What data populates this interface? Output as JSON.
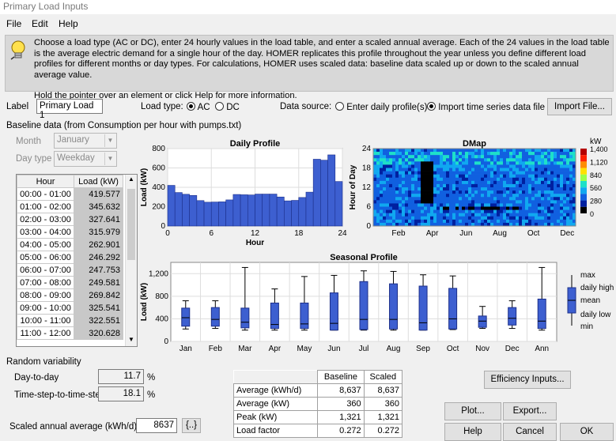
{
  "window": {
    "title": "Primary Load Inputs"
  },
  "menu": [
    "File",
    "Edit",
    "Help"
  ],
  "info": {
    "text": "Choose a load type (AC or DC), enter 24 hourly values in the load table, and enter a scaled annual average. Each of the 24 values in the load table is the average electric demand for a single hour of the day. HOMER replicates this profile throughout the year unless you define different load profiles for different months or day types. For calculations, HOMER uses scaled data: baseline data scaled up or down to the scaled annual average value.",
    "hint": "Hold the pointer over an element or click Help for more information."
  },
  "label_row": {
    "label": "Label",
    "label_value": "Primary Load 1",
    "load_type_label": "Load type:",
    "ac": "AC",
    "dc": "DC",
    "data_source_label": "Data source:",
    "enter_daily": "Enter daily profile(s)",
    "import_ts": "Import time series data file",
    "import_button": "Import File..."
  },
  "baseline_title": "Baseline data (from Consumption per hour with pumps.txt)",
  "month": {
    "label": "Month",
    "value": "January"
  },
  "day_type": {
    "label": "Day type",
    "value": "Weekday"
  },
  "load_table": {
    "headers": [
      "Hour",
      "Load (kW)"
    ],
    "rows": [
      [
        "00:00 - 01:00",
        "419.577"
      ],
      [
        "01:00 - 02:00",
        "345.632"
      ],
      [
        "02:00 - 03:00",
        "327.641"
      ],
      [
        "03:00 - 04:00",
        "315.979"
      ],
      [
        "04:00 - 05:00",
        "262.901"
      ],
      [
        "05:00 - 06:00",
        "246.292"
      ],
      [
        "06:00 - 07:00",
        "247.753"
      ],
      [
        "07:00 - 08:00",
        "249.581"
      ],
      [
        "08:00 - 09:00",
        "269.842"
      ],
      [
        "09:00 - 10:00",
        "325.541"
      ],
      [
        "10:00 - 11:00",
        "322.551"
      ],
      [
        "11:00 - 12:00",
        "320.628"
      ]
    ]
  },
  "random_variability": {
    "title": "Random variability",
    "day_to_day_label": "Day-to-day",
    "day_to_day_value": "11.7",
    "timestep_label": "Time-step-to-time-step",
    "timestep_value": "18.1",
    "unit": "%"
  },
  "scaled": {
    "label": "Scaled annual average (kWh/d)",
    "value": "8637",
    "button": "{..}"
  },
  "stats": {
    "headers": [
      "",
      "Baseline",
      "Scaled"
    ],
    "rows": [
      [
        "Average (kWh/d)",
        "8,637",
        "8,637"
      ],
      [
        "Average (kW)",
        "360",
        "360"
      ],
      [
        "Peak (kW)",
        "1,321",
        "1,321"
      ],
      [
        "Load factor",
        "0.272",
        "0.272"
      ]
    ]
  },
  "buttons": {
    "efficiency": "Efficiency Inputs...",
    "plot": "Plot...",
    "export": "Export...",
    "help": "Help",
    "cancel": "Cancel",
    "ok": "OK"
  },
  "chart_data": [
    {
      "type": "bar",
      "title": "Daily Profile",
      "xlabel": "Hour",
      "ylabel": "Load (kW)",
      "x": [
        0,
        1,
        2,
        3,
        4,
        5,
        6,
        7,
        8,
        9,
        10,
        11,
        12,
        13,
        14,
        15,
        16,
        17,
        18,
        19,
        20,
        21,
        22,
        23
      ],
      "values": [
        420,
        346,
        328,
        316,
        263,
        246,
        248,
        250,
        270,
        326,
        323,
        321,
        330,
        330,
        330,
        300,
        260,
        265,
        295,
        350,
        690,
        680,
        735,
        460
      ],
      "xticks": [
        "0",
        "6",
        "12",
        "18",
        "24"
      ],
      "yticks": [
        "0",
        "200",
        "400",
        "600",
        "800"
      ],
      "ylim": [
        0,
        800
      ],
      "xlim": [
        0,
        24
      ],
      "bar_color": "#3d5fd0",
      "grid": true
    },
    {
      "type": "heatmap",
      "title": "DMap",
      "ylabel": "Hour of Day",
      "xticks": [
        "Feb",
        "Apr",
        "Jun",
        "Aug",
        "Oct",
        "Dec"
      ],
      "yticks": [
        "0",
        "6",
        "12",
        "18",
        "24"
      ],
      "colorbar": {
        "unit": "kW",
        "labels": [
          "1,400",
          "1,120",
          "840",
          "560",
          "280",
          "0"
        ],
        "colors": [
          "#b40000",
          "#ff2000",
          "#ff8c00",
          "#ffe000",
          "#9aff4a",
          "#1ee0c8",
          "#10a8f0",
          "#1060e0",
          "#0020a0",
          "#000000"
        ]
      }
    },
    {
      "type": "boxplot",
      "title": "Seasonal Profile",
      "ylabel": "Load (kW)",
      "categories": [
        "Jan",
        "Feb",
        "Mar",
        "Apr",
        "May",
        "Jun",
        "Jul",
        "Aug",
        "Sep",
        "Oct",
        "Nov",
        "Dec",
        "Ann"
      ],
      "yticks": [
        "0",
        "400",
        "800",
        "1,200"
      ],
      "ylim": [
        0,
        1400
      ],
      "stats": [
        {
          "min": 220,
          "low": 270,
          "mean": 420,
          "high": 590,
          "max": 720
        },
        {
          "min": 230,
          "low": 270,
          "mean": 390,
          "high": 600,
          "max": 720
        },
        {
          "min": 200,
          "low": 240,
          "mean": 340,
          "high": 590,
          "max": 1310
        },
        {
          "min": 200,
          "low": 230,
          "mean": 300,
          "high": 680,
          "max": 930
        },
        {
          "min": 200,
          "low": 230,
          "mean": 310,
          "high": 680,
          "max": 1150
        },
        {
          "min": 200,
          "low": 200,
          "mean": 320,
          "high": 860,
          "max": 1170
        },
        {
          "min": 200,
          "low": 210,
          "mean": 390,
          "high": 1060,
          "max": 1250
        },
        {
          "min": 200,
          "low": 220,
          "mean": 390,
          "high": 1020,
          "max": 1240
        },
        {
          "min": 200,
          "low": 200,
          "mean": 330,
          "high": 980,
          "max": 1180
        },
        {
          "min": 210,
          "low": 220,
          "mean": 400,
          "high": 940,
          "max": 1160
        },
        {
          "min": 230,
          "low": 250,
          "mean": 360,
          "high": 450,
          "max": 620
        },
        {
          "min": 230,
          "low": 290,
          "mean": 410,
          "high": 600,
          "max": 720
        },
        {
          "min": 200,
          "low": 230,
          "mean": 360,
          "high": 750,
          "max": 1310
        }
      ],
      "legend": [
        "max",
        "daily high",
        "mean",
        "daily low",
        "min"
      ],
      "box_color": "#3d5fd0"
    }
  ]
}
